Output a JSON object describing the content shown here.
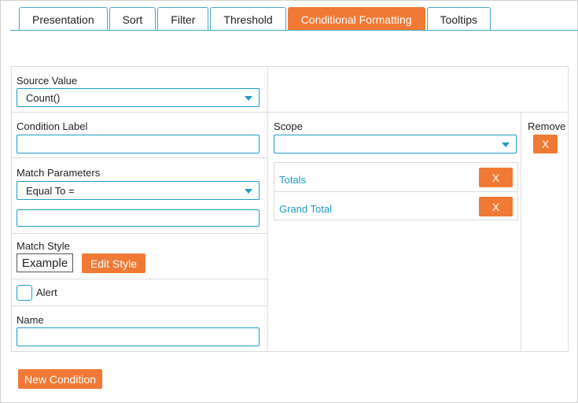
{
  "tabs": [
    {
      "label": "Presentation"
    },
    {
      "label": "Sort"
    },
    {
      "label": "Filter"
    },
    {
      "label": "Threshold"
    },
    {
      "label": "Conditional Formatting",
      "active": true
    },
    {
      "label": "Tooltips"
    }
  ],
  "form": {
    "source_value": {
      "label": "Source Value",
      "selected": "Count()"
    },
    "condition_label": {
      "label": "Condition Label",
      "value": ""
    },
    "match_parameters": {
      "label": "Match Parameters",
      "selected": "Equal To =",
      "value": ""
    },
    "match_style": {
      "label": "Match Style",
      "example": "Example",
      "edit_button": "Edit Style"
    },
    "alert": {
      "label": "Alert",
      "checked": false
    },
    "name": {
      "label": "Name",
      "value": ""
    }
  },
  "scope": {
    "label": "Scope",
    "selected": "",
    "items": [
      {
        "label": "Totals",
        "remove": "X"
      },
      {
        "label": "Grand Total",
        "remove": "X"
      }
    ]
  },
  "remove": {
    "label": "Remove",
    "button": "X"
  },
  "new_condition_button": "New Condition",
  "colors": {
    "accent": "#f07a35",
    "border_blue": "#1e9cc8"
  }
}
